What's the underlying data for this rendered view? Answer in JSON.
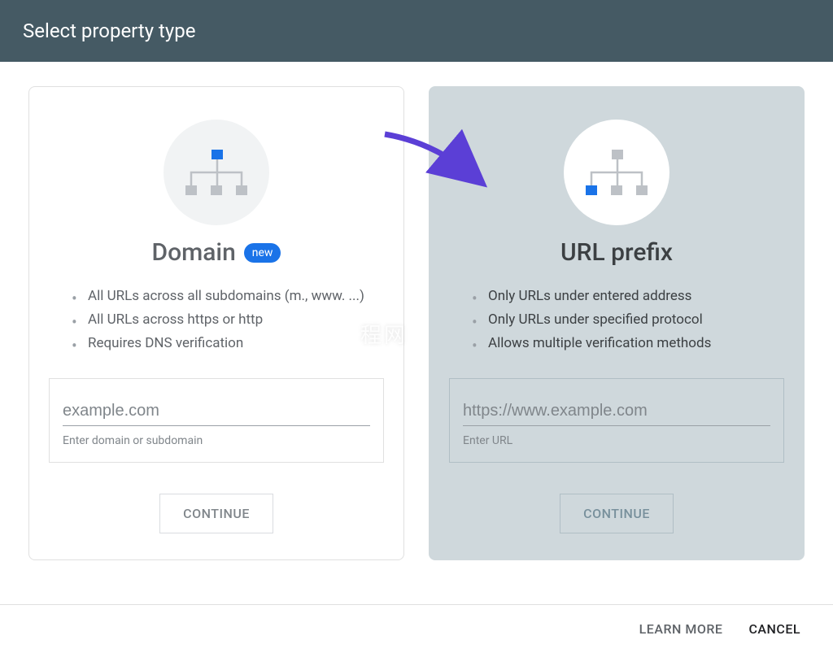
{
  "header": {
    "title": "Select property type"
  },
  "cards": {
    "domain": {
      "title": "Domain",
      "badge": "new",
      "bullets": [
        "All URLs across all subdomains (m., www. ...)",
        "All URLs across https or http",
        "Requires DNS verification"
      ],
      "input_placeholder": "example.com",
      "input_hint": "Enter domain or subdomain",
      "continue": "CONTINUE"
    },
    "url_prefix": {
      "title": "URL prefix",
      "bullets": [
        "Only URLs under entered address",
        "Only URLs under specified protocol",
        "Allows multiple verification methods"
      ],
      "input_placeholder": "https://www.example.com",
      "input_hint": "Enter URL",
      "continue": "CONTINUE"
    }
  },
  "footer": {
    "learn_more": "LEARN MORE",
    "cancel": "CANCEL"
  },
  "watermark": "程网"
}
